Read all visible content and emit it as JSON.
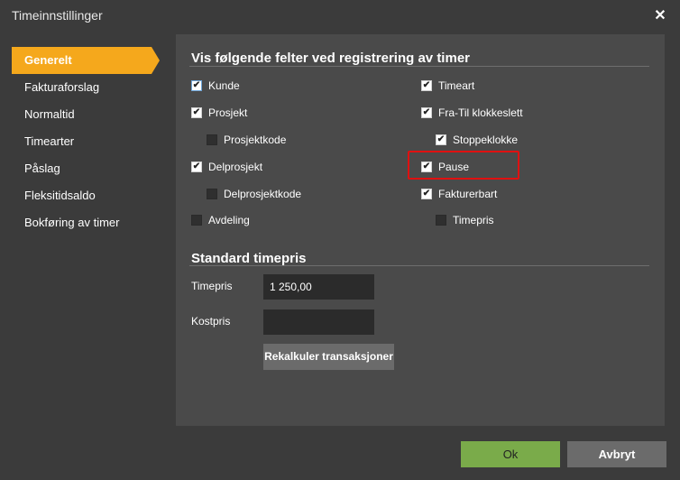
{
  "window": {
    "title": "Timeinnstillinger"
  },
  "sidebar": {
    "items": [
      {
        "label": "Generelt",
        "active": true
      },
      {
        "label": "Fakturaforslag"
      },
      {
        "label": "Normaltid"
      },
      {
        "label": "Timearter"
      },
      {
        "label": "Påslag"
      },
      {
        "label": "Fleksitidsaldo"
      },
      {
        "label": "Bokføring av timer"
      }
    ]
  },
  "fields_section": {
    "title": "Vis følgende felter ved registrering av timer",
    "left": [
      {
        "label": "Kunde",
        "checked": true
      },
      {
        "label": "Prosjekt",
        "checked": true
      },
      {
        "label": "Prosjektkode",
        "checked": false
      },
      {
        "label": "Delprosjekt",
        "checked": true
      },
      {
        "label": "Delprosjektkode",
        "checked": false
      },
      {
        "label": "Avdeling",
        "checked": false
      }
    ],
    "right": [
      {
        "label": "Timeart",
        "checked": true
      },
      {
        "label": "Fra-Til klokkeslett",
        "checked": true
      },
      {
        "label": "Stoppeklokke",
        "checked": true
      },
      {
        "label": "Pause",
        "checked": true
      },
      {
        "label": "Fakturerbart",
        "checked": true
      },
      {
        "label": "Timepris",
        "checked": false
      }
    ]
  },
  "rate_section": {
    "title": "Standard timepris",
    "timepris_label": "Timepris",
    "timepris_value": "1 250,00",
    "kostpris_label": "Kostpris",
    "kostpris_value": "",
    "recalc_label": "Rekalkuler transaksjoner"
  },
  "footer": {
    "ok_label": "Ok",
    "cancel_label": "Avbryt"
  },
  "colors": {
    "accent": "#f5a81c",
    "ok": "#7aab4a",
    "highlight": "#e01010"
  }
}
